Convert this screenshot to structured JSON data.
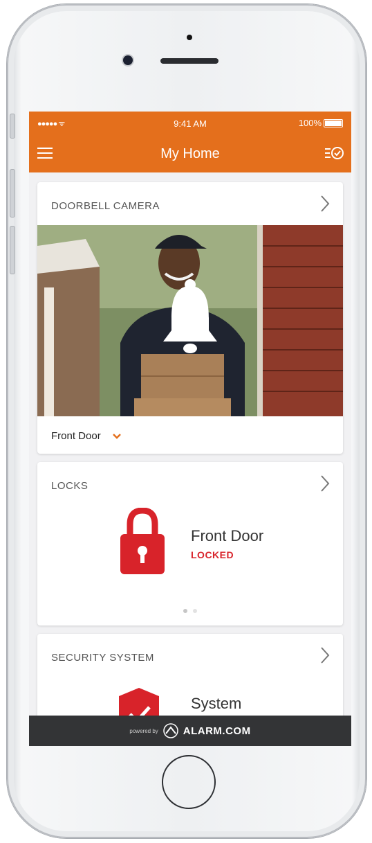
{
  "status_bar": {
    "signal": "●●●●● ᯤ",
    "time": "9:41 AM",
    "battery": "100%"
  },
  "header": {
    "title": "My Home"
  },
  "doorbell_card": {
    "title": "DOORBELL CAMERA",
    "selected_camera": "Front Door"
  },
  "locks_card": {
    "title": "LOCKS",
    "device_name": "Front Door",
    "status": "LOCKED",
    "pager_total": 2,
    "pager_active": 1
  },
  "security_card": {
    "title": "SECURITY SYSTEM",
    "device_name": "System"
  },
  "footer": {
    "powered_by": "powered by",
    "brand": "ALARM.COM"
  },
  "colors": {
    "accent": "#e46f1c",
    "lock_red": "#d8232a",
    "footer_bg": "#333436"
  }
}
